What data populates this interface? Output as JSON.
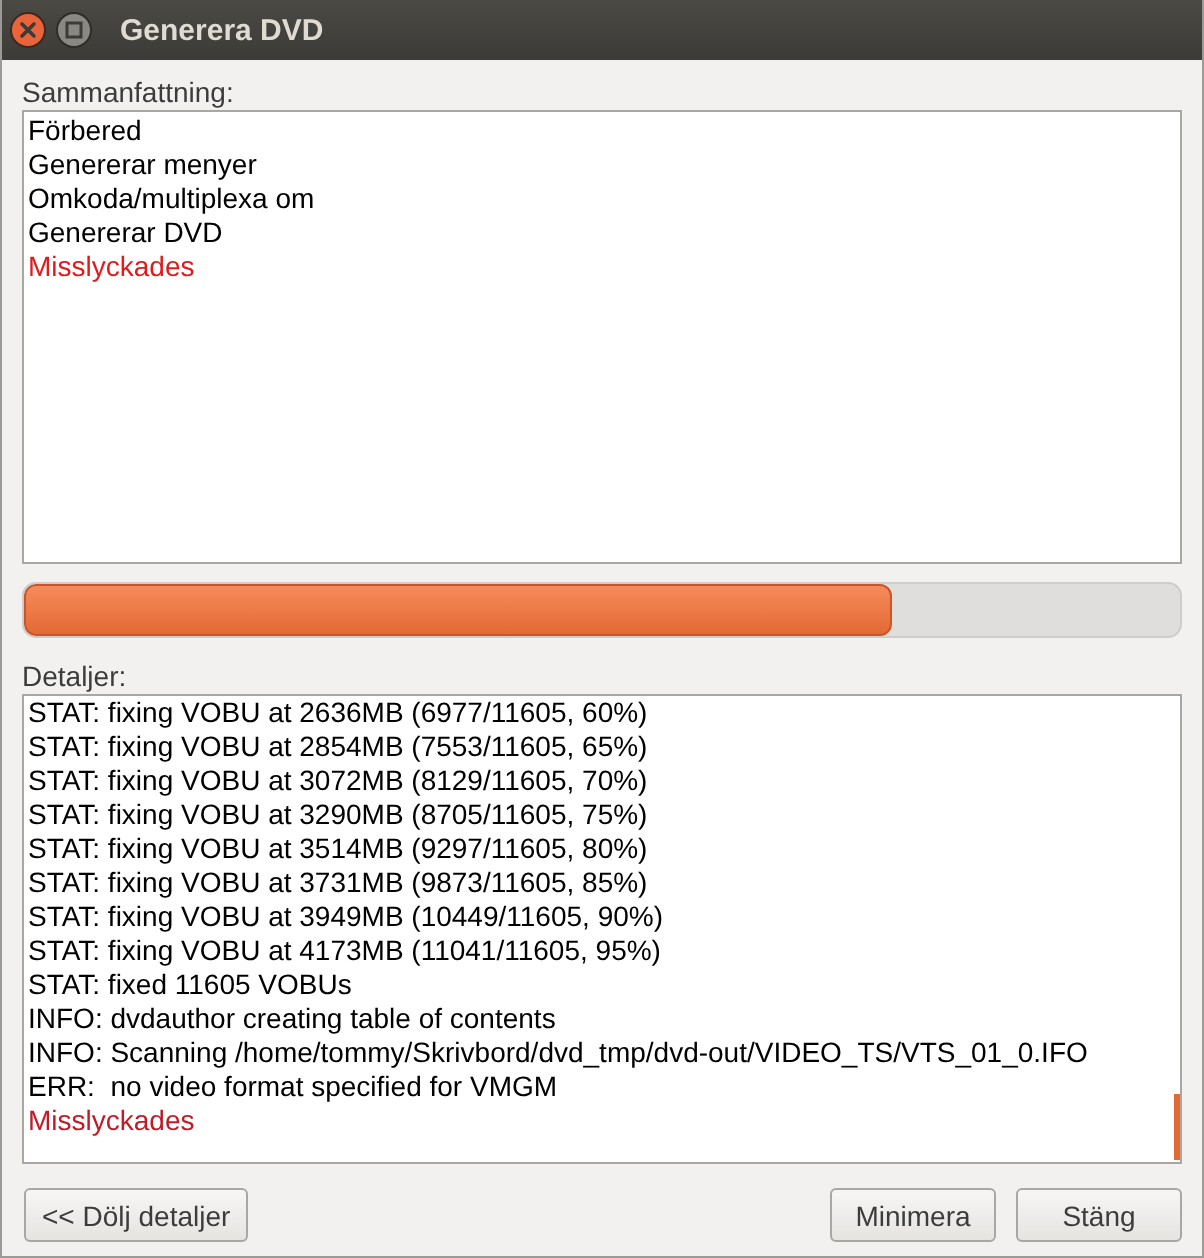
{
  "window": {
    "title": "Generera DVD"
  },
  "summary": {
    "label": "Sammanfattning:",
    "lines": [
      {
        "text": "Förbered",
        "color": "#000000"
      },
      {
        "text": "Genererar menyer",
        "color": "#000000"
      },
      {
        "text": "Omkoda/multiplexa om",
        "color": "#000000"
      },
      {
        "text": "Genererar DVD",
        "color": "#000000"
      },
      {
        "text": "Misslyckades",
        "color": "#e01b1b"
      }
    ]
  },
  "progress": {
    "level": 0.75
  },
  "details": {
    "label": "Detaljer:",
    "lines": [
      {
        "text": "STAT: fixing VOBU at 2636MB (6977/11605, 60%)",
        "color": "#000000"
      },
      {
        "text": "STAT: fixing VOBU at 2854MB (7553/11605, 65%)",
        "color": "#000000"
      },
      {
        "text": "STAT: fixing VOBU at 3072MB (8129/11605, 70%)",
        "color": "#000000"
      },
      {
        "text": "STAT: fixing VOBU at 3290MB (8705/11605, 75%)",
        "color": "#000000"
      },
      {
        "text": "STAT: fixing VOBU at 3514MB (9297/11605, 80%)",
        "color": "#000000"
      },
      {
        "text": "STAT: fixing VOBU at 3731MB (9873/11605, 85%)",
        "color": "#000000"
      },
      {
        "text": "STAT: fixing VOBU at 3949MB (10449/11605, 90%)",
        "color": "#000000"
      },
      {
        "text": "STAT: fixing VOBU at 4173MB (11041/11605, 95%)",
        "color": "#000000"
      },
      {
        "text": "STAT: fixed 11605 VOBUs",
        "color": "#000000"
      },
      {
        "text": "INFO: dvdauthor creating table of contents",
        "color": "#000000"
      },
      {
        "text": "INFO: Scanning /home/tommy/Skrivbord/dvd_tmp/dvd-out/VIDEO_TS/VTS_01_0.IFO",
        "color": "#000000"
      },
      {
        "text": "ERR:  no video format specified for VMGM",
        "color": "#000000"
      },
      {
        "text": "Misslyckades",
        "color": "#c01c28"
      }
    ]
  },
  "buttons": [
    {
      "label": "<< Dölj detaljer"
    },
    {
      "label": "Minimera"
    },
    {
      "label": "Stäng"
    }
  ]
}
